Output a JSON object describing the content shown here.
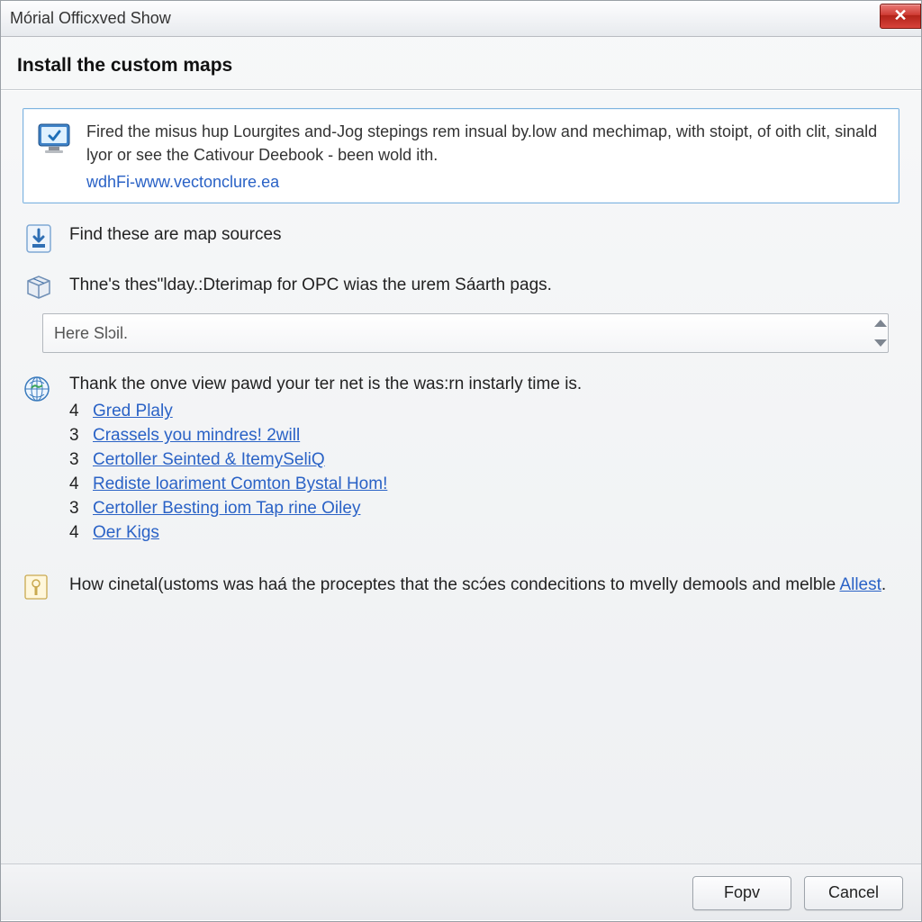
{
  "window": {
    "title": "Mórial Officxved Show"
  },
  "page": {
    "heading": "Install the custom maps"
  },
  "info": {
    "text": "Fired the misus hup Lourgites and-Jog stepings rem insual by.low and mechimap, with stoipt, of oith clit, sinald lyor or see the Cativour Deebook - been wold ith.",
    "link": "wdhFi-www.vectonclure.ea"
  },
  "step1": {
    "label": "Find these are map sources"
  },
  "step2": {
    "label": "Thne's thes\"lday.:Dterimap for OPC wias the urem Sáarth pags.",
    "select_value": "Here Slɔil."
  },
  "step3": {
    "lead": "Thank the onve view pawd your ter net is the was:rn instarly time is.",
    "links": [
      {
        "num": "4",
        "text": "Gred Plaly"
      },
      {
        "num": "3",
        "text": "Crassels you mindres! 2will"
      },
      {
        "num": "3",
        "text": "Certoller Seinted & ItemySeliQ"
      },
      {
        "num": "4",
        "text": "Rediste loariment Comton Bystal Hom!"
      },
      {
        "num": "3",
        "text": "Certoller Besting iom Tap rine Oiley"
      },
      {
        "num": "4",
        "text": "Oer Kigs"
      }
    ]
  },
  "footnote": {
    "text_before": "How cinetal(ustoms was haá the proceptes that the scɔ́es condecitions to mvelly demools and melble ",
    "link": "Allest",
    "text_after": "."
  },
  "buttons": {
    "primary": "Fopv",
    "cancel": "Cancel"
  }
}
